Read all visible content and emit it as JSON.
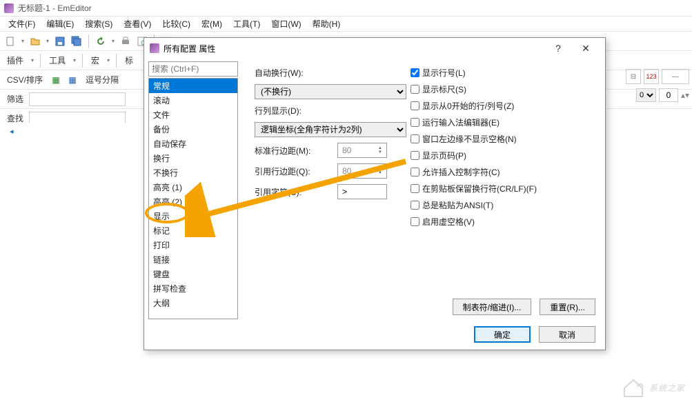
{
  "title": "无标题-1 - EmEditor",
  "menus": [
    "文件(F)",
    "编辑(E)",
    "搜索(S)",
    "查看(V)",
    "比较(C)",
    "宏(M)",
    "工具(T)",
    "窗口(W)",
    "帮助(H)"
  ],
  "toolbar2": {
    "plugin": "插件",
    "tools": "工具",
    "macro": "宏",
    "mark": "标"
  },
  "toolbar3": {
    "csv": "CSV/排序",
    "comma": "逗号分隔"
  },
  "toolbar4": {
    "filter": "筛选"
  },
  "toolbar5": {
    "find": "查找"
  },
  "tab": {
    "name": "无标题-1"
  },
  "rightnum": "123",
  "right2": {
    "opt": "0",
    "val": "0"
  },
  "dialog": {
    "title": "所有配置 属性",
    "search_placeholder": "搜索 (Ctrl+F)",
    "categories": [
      "常规",
      "滚动",
      "文件",
      "备份",
      "自动保存",
      "换行",
      "不换行",
      "高亮 (1)",
      "高亮 (2)",
      "显示",
      "标记",
      "打印",
      "链接",
      "键盘",
      "拼写检查",
      "大纲"
    ],
    "selected_category": "常规",
    "labels": {
      "autowrap": "自动换行(W):",
      "autowrap_value": "(不换行)",
      "rowcol": "行列显示(D):",
      "rowcol_value": "逻辑坐标(全角字符计为2列)",
      "std_margin": "标准行边距(M):",
      "std_margin_value": "80",
      "quote_margin": "引用行边距(Q):",
      "quote_margin_value": "80",
      "quote_char": "引用字符(U):",
      "quote_char_value": ">"
    },
    "checks": [
      {
        "label": "显示行号(L)",
        "checked": true
      },
      {
        "label": "显示标尺(S)",
        "checked": false
      },
      {
        "label": "显示从0开始的行/列号(Z)",
        "checked": false
      },
      {
        "label": "运行输入法编辑器(E)",
        "checked": false
      },
      {
        "label": "窗口左边缘不显示空格(N)",
        "checked": false
      },
      {
        "label": "显示页码(P)",
        "checked": false
      },
      {
        "label": "允许插入控制字符(C)",
        "checked": false
      },
      {
        "label": "在剪贴板保留换行符(CR/LF)(F)",
        "checked": false
      },
      {
        "label": "总是粘贴为ANSI(T)",
        "checked": false
      },
      {
        "label": "启用虚空格(V)",
        "checked": false
      }
    ],
    "tabindent_btn": "制表符/缩进(I)...",
    "reset_btn": "重置(R)...",
    "ok": "确定",
    "cancel": "取消"
  },
  "watermark": "系统之家"
}
